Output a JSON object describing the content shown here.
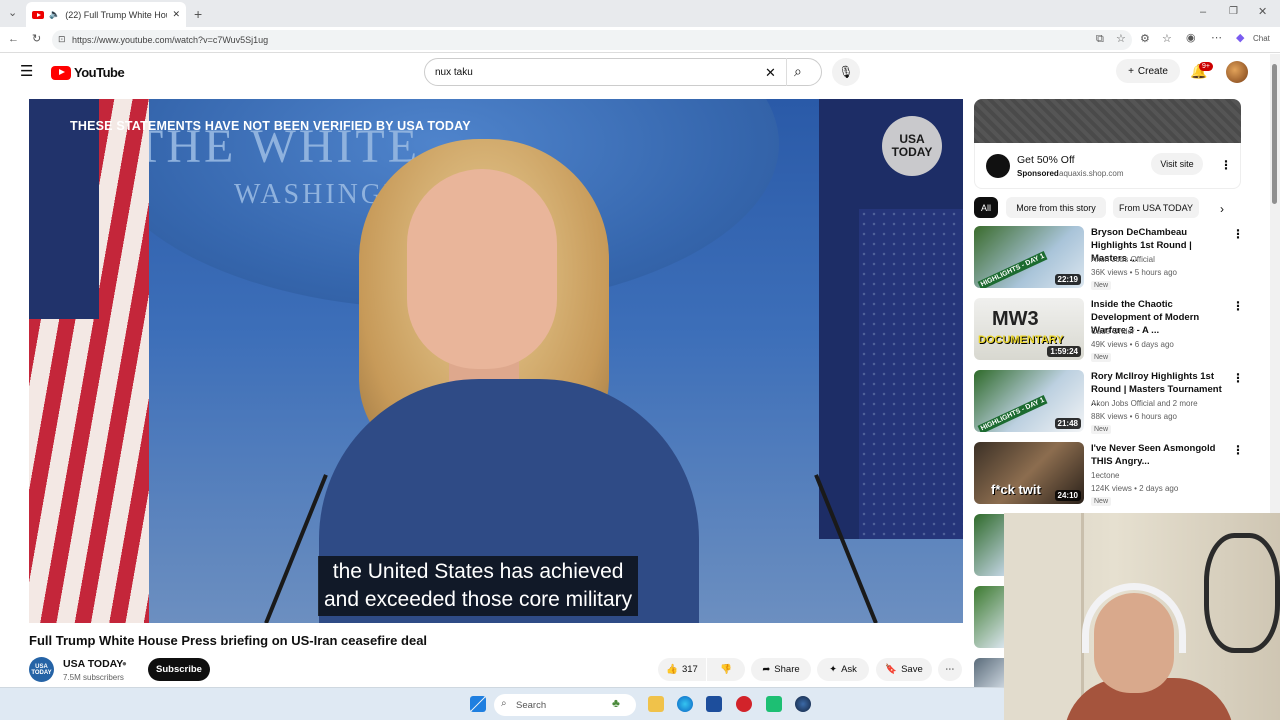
{
  "browser": {
    "tab_title": "(22) Full Trump White House P",
    "url": "https://www.youtube.com/watch?v=c7Wuv5Sj1ug",
    "chat_label": "Chat"
  },
  "youtube": {
    "logo_text": "YouTube",
    "search_query": "nux taku",
    "create_label": "Create",
    "notification_count": "9+"
  },
  "video": {
    "disclaimer": "THESE STATEMENTS HAVE NOT BEEN VERIFIED BY USA TODAY",
    "backdrop_line1": "THE WHITE",
    "backdrop_line2": "WASHINGTON",
    "corner_logo": "USA TODAY",
    "caption_line1": "the United States has achieved",
    "caption_line2": "and exceeded those core military",
    "title": "Full Trump White House Press briefing on US-Iran ceasefire deal",
    "channel_name": "USA TODAY",
    "channel_avatar_text": "USA TODAY",
    "subscribers": "7.5M subscribers",
    "subscribe_label": "Subscribe",
    "likes": "317",
    "share_label": "Share",
    "ask_label": "Ask",
    "save_label": "Save"
  },
  "ad": {
    "title": "Get 50% Off",
    "sponsored_label": "Sponsored",
    "domain": "aquaxis.shop.com",
    "visit_label": "Visit site"
  },
  "chips": [
    "All",
    "More from this story",
    "From USA TODAY"
  ],
  "recommendations": [
    {
      "title": "Bryson DeChambeau Highlights 1st Round | Masters ...",
      "channel": "Akon Jobs Official",
      "meta": "36K views • 5 hours ago",
      "duration": "22:19",
      "badge": "New"
    },
    {
      "title": "Inside the Chaotic Development of Modern Warfare 3 - A ...",
      "channel": "Cade Onder",
      "meta": "49K views • 6 days ago",
      "duration": "1:59:24",
      "badge": "New"
    },
    {
      "title": "Rory McIlroy Highlights 1st Round | Masters Tournament ...",
      "channel": "Akon Jobs Official and 2 more",
      "meta": "88K views • 6 hours ago",
      "duration": "21:48",
      "badge": "New"
    },
    {
      "title": "I've Never Seen Asmongold THIS Angry...",
      "channel": "1ectone",
      "meta": "124K views • 2 days ago",
      "duration": "24:10",
      "badge": "New"
    }
  ],
  "thumb_texts": [
    "HIGHLIGHTS - DAY 1",
    "DOCUMENTARY",
    "HIGHLIGHTS - DAY 1",
    "f*ck twit"
  ],
  "taskbar": {
    "search_placeholder": "Search"
  },
  "colors": {
    "youtube_red": "#ff0000",
    "subscribe_bg": "#0f0f0f",
    "caption_bg": "#080808"
  }
}
